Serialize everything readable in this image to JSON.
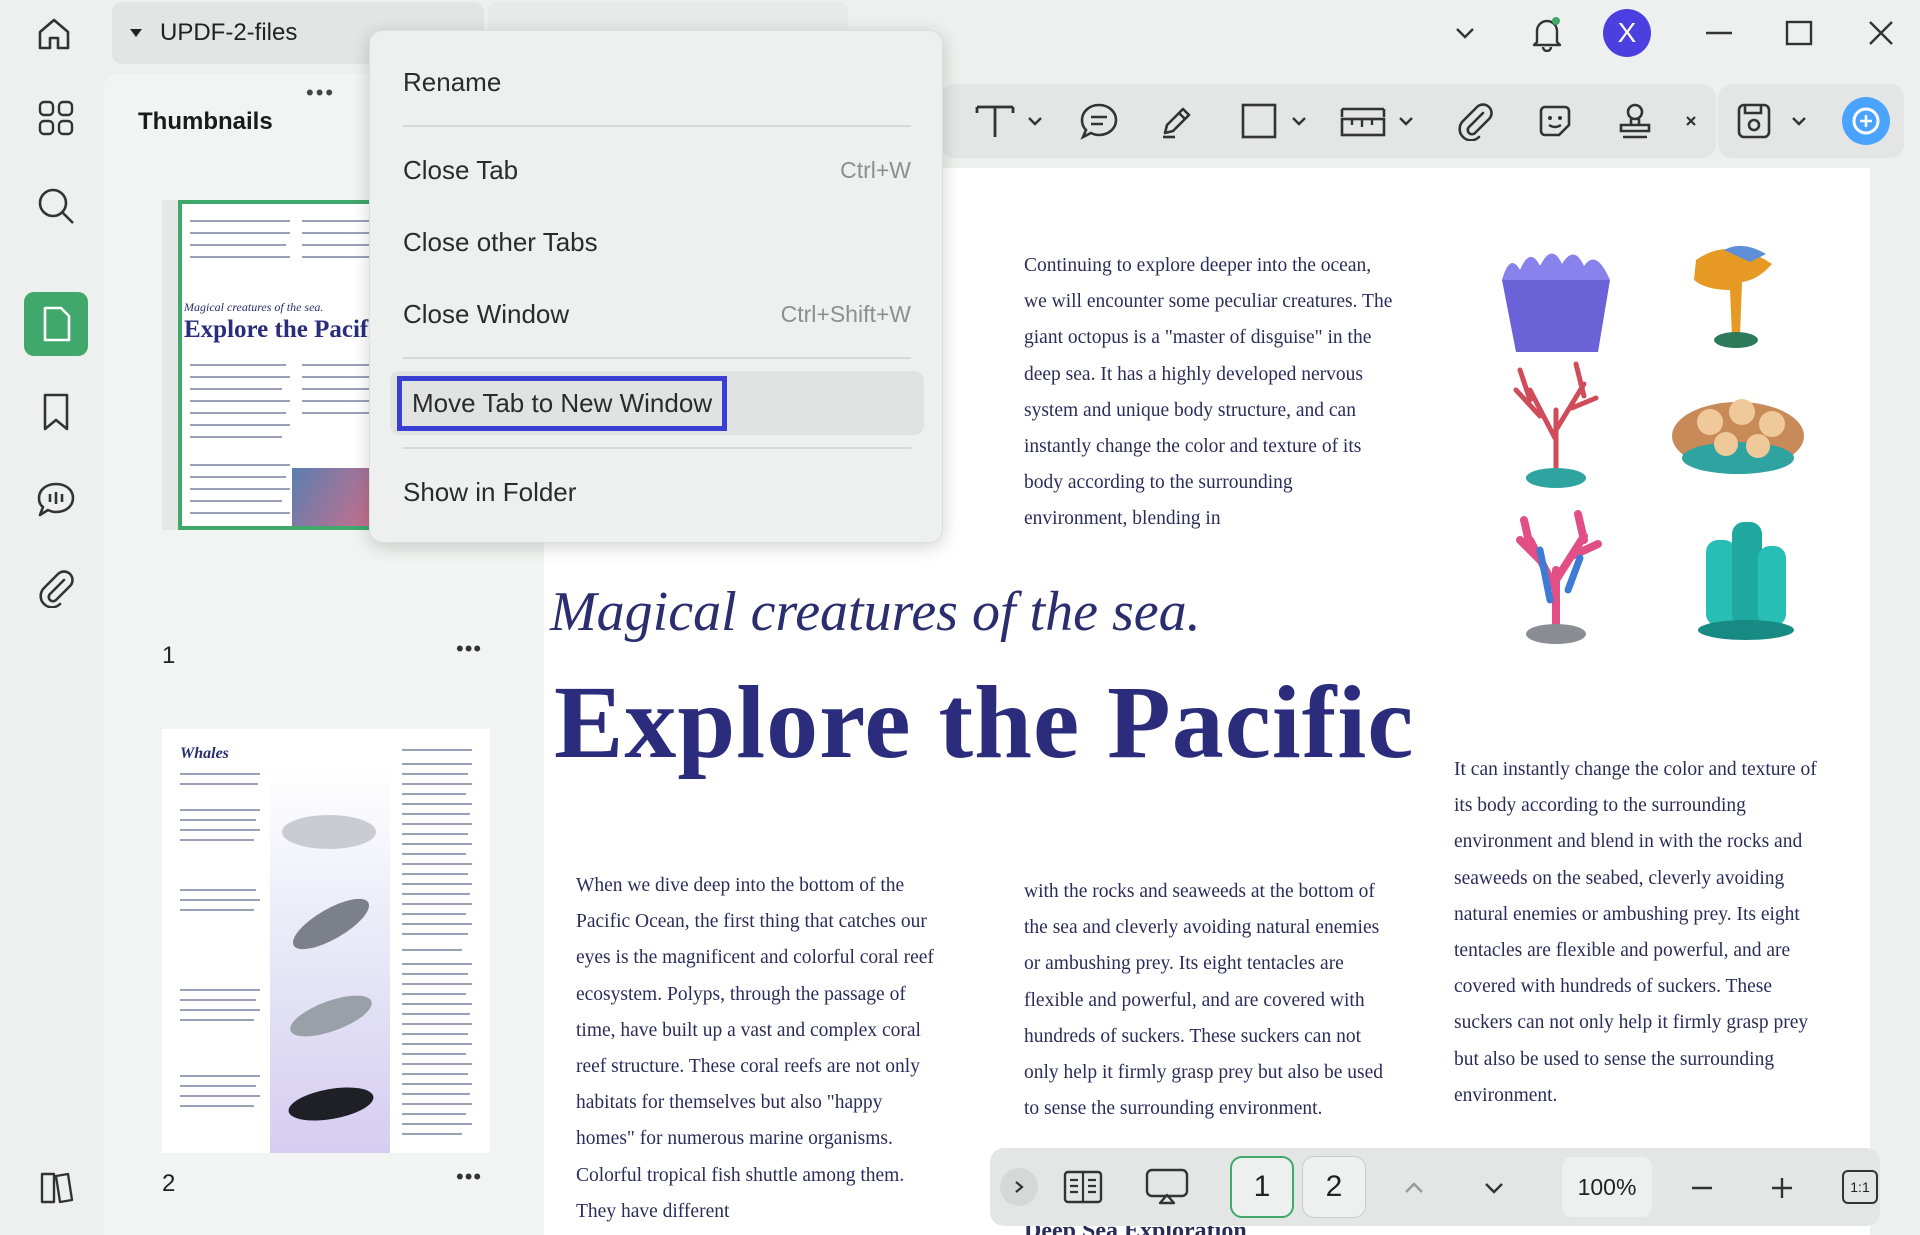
{
  "window": {
    "active_tab_title": "UPDF-2-files",
    "avatar_letter": "X",
    "brand_color": "#3fa86a",
    "avatar_color": "#4b3fe0"
  },
  "sidebar": {
    "panel_title": "Thumbnails",
    "thumbnails": [
      {
        "page": "1",
        "heading_small": "Magical creatures of the sea.",
        "heading_big": "Explore the Pacific"
      },
      {
        "page": "2",
        "heading_small": "Whales"
      }
    ]
  },
  "context_menu": {
    "items": [
      {
        "label": "Rename",
        "shortcut": ""
      },
      {
        "label": "Close Tab",
        "shortcut": "Ctrl+W"
      },
      {
        "label": "Close other Tabs",
        "shortcut": ""
      },
      {
        "label": "Close Window",
        "shortcut": "Ctrl+Shift+W"
      },
      {
        "label": "Move Tab to New Window",
        "shortcut": ""
      },
      {
        "label": "Show in Folder",
        "shortcut": ""
      }
    ],
    "highlight_color": "#3a3fd4"
  },
  "document": {
    "intro_paragraph": "Continuing to explore deeper into the ocean, we will encounter some peculiar creatures. The giant octopus is a \"master of disguise\" in the deep sea. It has a highly developed nervous system and unique body structure, and can instantly change the color and texture of its body according to the surrounding environment, blending in",
    "subtitle": "Magical creatures of the sea.",
    "title": "Explore the Pacific",
    "col1": "When we dive deep into the bottom of the Pacific Ocean, the first thing that catches our eyes is the magnificent and colorful coral reef ecosystem. Polyps, through the passage of time, have built up a vast and complex coral reef structure. These coral reefs are not only habitats for themselves but also \"happy homes\" for numerous marine organisms. Colorful tropical fish shuttle among them. They have different",
    "col2": "with the rocks and seaweeds at the bottom of the sea and cleverly avoiding natural enemies or ambushing prey. Its eight tentacles are flexible and powerful, and are covered with hundreds of suckers. These suckers can not only help it firmly grasp prey but also be used to sense the surrounding environment.",
    "col3": "It can instantly change the color and texture of its body according to the surrounding environment and blend in with the rocks and seaweeds on the seabed, cleverly avoiding natural enemies or ambushing prey. Its eight tentacles are flexible and powerful, and are covered with hundreds of suckers. These suckers can not only help it firmly grasp prey but also be used to sense the surrounding environment.",
    "section_heading": "Deep Sea Exploration"
  },
  "bottom_bar": {
    "pages": [
      "1",
      "2"
    ],
    "current_page": "1",
    "zoom": "100%",
    "fit_label": "1:1"
  }
}
